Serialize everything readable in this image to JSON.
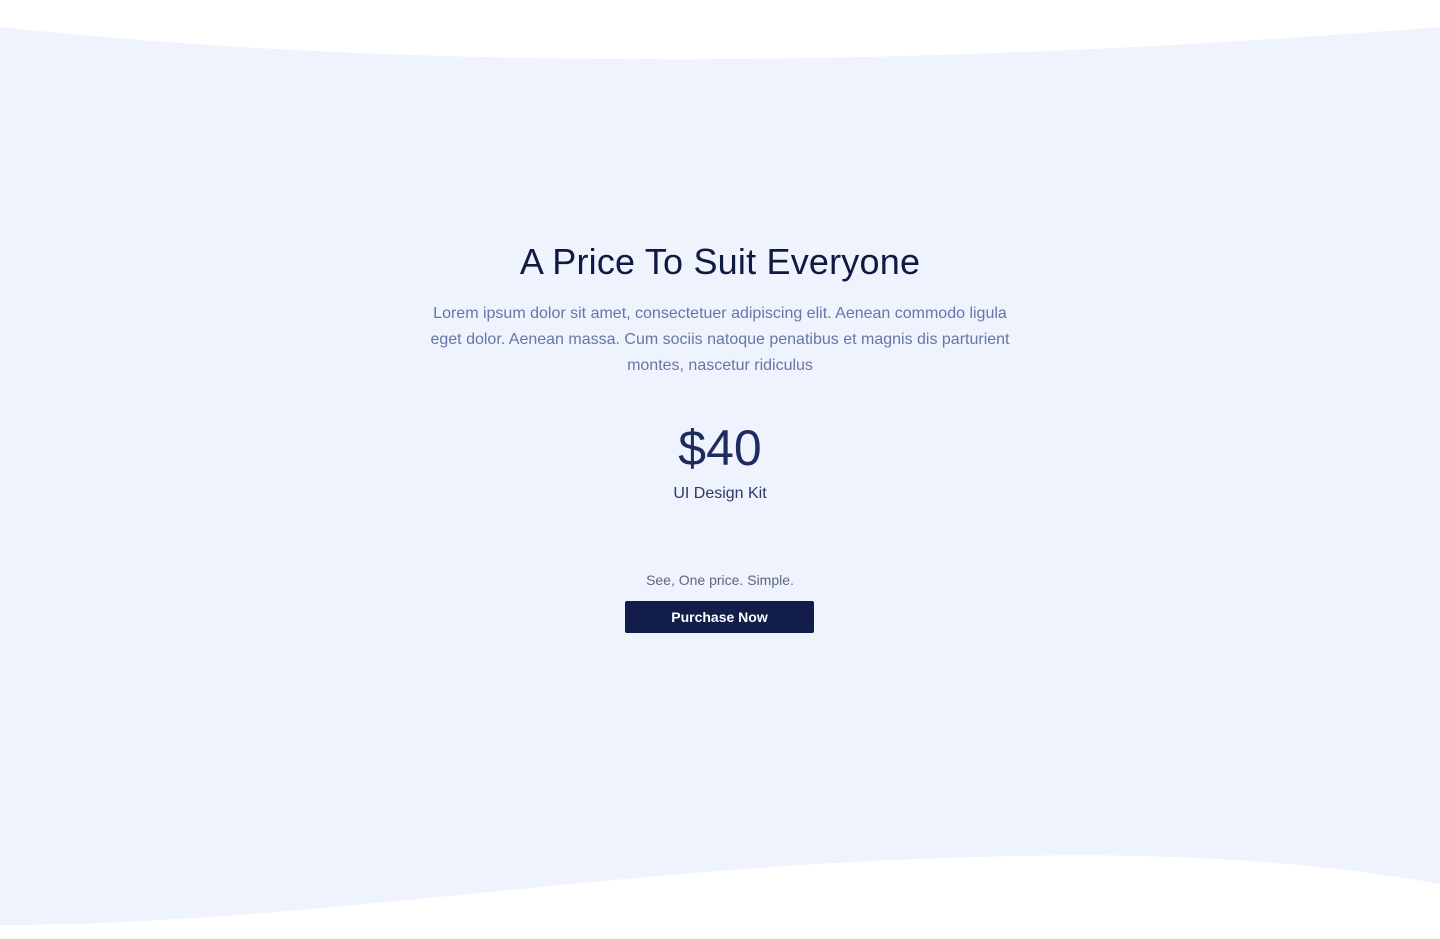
{
  "section": {
    "heading": "A Price To Suit Everyone",
    "description": "Lorem ipsum dolor sit amet, consectetuer adipiscing elit. Aenean commodo ligula eget dolor. Aenean massa. Cum sociis natoque penatibus et magnis dis parturient montes, nascetur ridiculus",
    "price": "$40",
    "product_name": "UI Design Kit",
    "tagline": "See, One price. Simple.",
    "purchase_label": "Purchase Now"
  },
  "colors": {
    "background_band": "#eff3fe",
    "page_background": "#ffffff",
    "heading": "#10193f",
    "description": "#6875a6",
    "price": "#1e2b5f",
    "button_background": "#121d4a",
    "button_text": "#ffffff"
  }
}
